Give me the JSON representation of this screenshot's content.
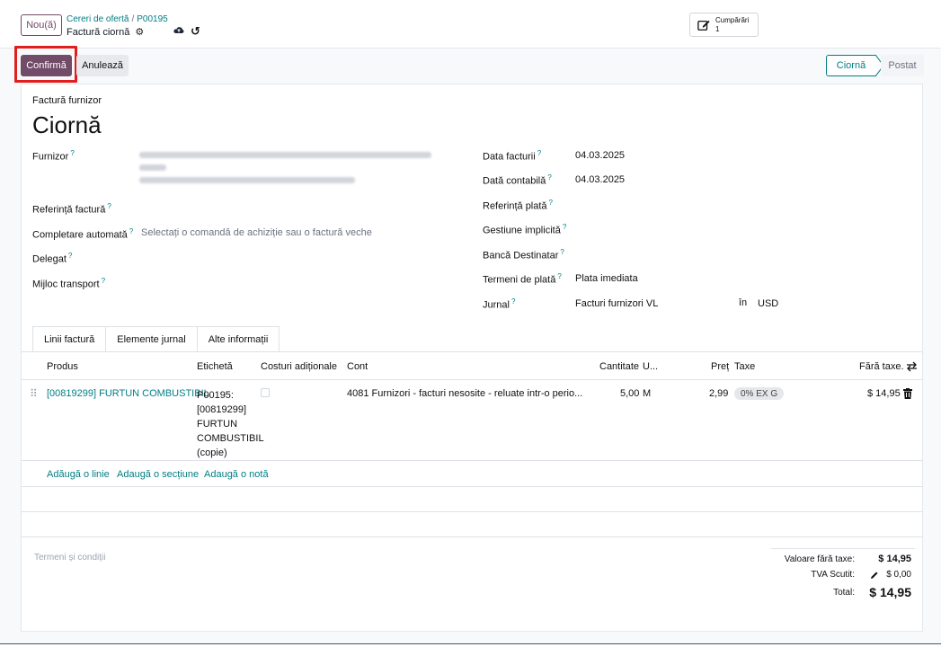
{
  "header": {
    "new_button": "Nou(ă)",
    "breadcrumb_parent": "Cereri de ofertă",
    "breadcrumb_separator": "/",
    "breadcrumb_record": "P00195",
    "record_title": "Factură ciornă",
    "purchases_label": "Cumpărări",
    "purchases_count": "1"
  },
  "actions": {
    "confirm": "Confirmă",
    "cancel": "Anulează"
  },
  "status": {
    "steps": [
      "Ciornă",
      "Postat"
    ],
    "active": "Ciornă"
  },
  "form": {
    "subtitle": "Factură furnizor",
    "title": "Ciornă",
    "left": {
      "vendor_label": "Furnizor",
      "bill_ref_label": "Referință factură",
      "autocomplete_label": "Completare automată",
      "autocomplete_placeholder": "Selectați o comandă de achiziție sau o factură veche",
      "delegate_label": "Delegat",
      "transport_label": "Mijloc transport"
    },
    "right": {
      "invoice_date_label": "Data facturii",
      "invoice_date": "04.03.2025",
      "accounting_date_label": "Dată contabilă",
      "accounting_date": "04.03.2025",
      "payment_ref_label": "Referință plată",
      "default_mgmt_label": "Gestiune implicită",
      "dest_bank_label": "Bancă Destinatar",
      "payment_terms_label": "Termeni de plată",
      "payment_terms": "Plata imediata",
      "journal_label": "Jurnal",
      "journal": "Facturi furnizori VL",
      "in_label": "în",
      "currency": "USD"
    }
  },
  "tabs": [
    "Linii factură",
    "Elemente jurnal",
    "Alte informații"
  ],
  "table": {
    "headers": {
      "product": "Produs",
      "label": "Etichetă",
      "extra_costs": "Costuri adiționale",
      "account": "Cont",
      "quantity": "Cantitate",
      "uom": "U...",
      "price": "Preț",
      "taxes": "Taxe",
      "subtotal": "Fără taxe."
    },
    "rows": [
      {
        "product": "[00819299] FURTUN COMBUSTIBIL",
        "label_lines": [
          "P00195:",
          "[00819299]",
          "FURTUN",
          "COMBUSTIBIL",
          "(copie)"
        ],
        "account": "4081 Furnizori - facturi nesosite - reluate intr-o perio...",
        "quantity": "5,00",
        "uom": "M",
        "price": "2,99",
        "tax": "0% EX G",
        "subtotal": "$ 14,95"
      }
    ],
    "add_line": "Adăugă o linie",
    "add_section": "Adaugă o secțiune",
    "add_note": "Adaugă o notă"
  },
  "terms_placeholder": "Termeni și condiții",
  "totals": {
    "untaxed_label": "Valoare fără taxe:",
    "untaxed": "$ 14,95",
    "tax_label": "TVA Scutit:",
    "tax": "$ 0,00",
    "total_label": "Total:",
    "total": "$ 14,95"
  },
  "colors": {
    "primary": "#714b67",
    "link": "#017e84",
    "highlight": "#e11d1d"
  }
}
